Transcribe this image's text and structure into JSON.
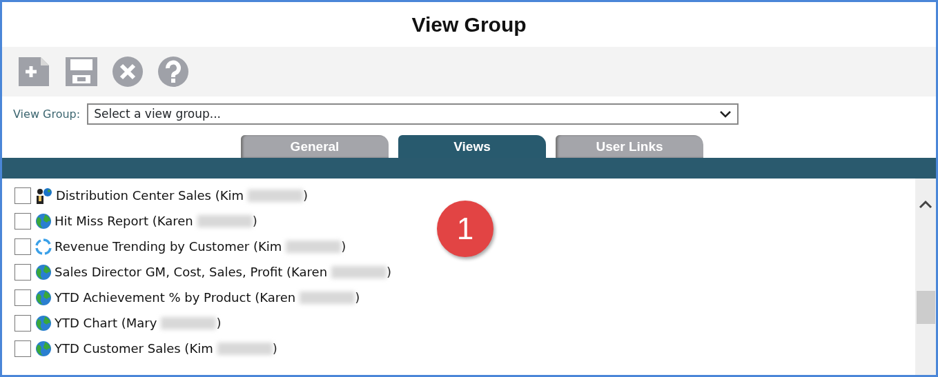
{
  "window": {
    "title": "View Group"
  },
  "toolbar": [
    {
      "kind": "new"
    },
    {
      "kind": "save"
    },
    {
      "kind": "cancel"
    },
    {
      "kind": "help"
    }
  ],
  "view_group": {
    "label": "View Group:",
    "value": "Select a view group..."
  },
  "tabs": [
    {
      "label": "General",
      "selected": false
    },
    {
      "label": "Views",
      "selected": true
    },
    {
      "label": "User Links",
      "selected": false
    }
  ],
  "views": [
    {
      "kind": "people",
      "label": "Distribution Center Sales (Kim",
      "after": ")",
      "checked": false
    },
    {
      "kind": "globe",
      "label": "Hit Miss Report (Karen",
      "after": ")",
      "checked": false
    },
    {
      "kind": "cycle",
      "label": "Revenue Trending by Customer (Kim",
      "after": ")",
      "checked": false
    },
    {
      "kind": "globe",
      "label": "Sales Director GM, Cost, Sales, Profit (Karen",
      "after": ")",
      "checked": false
    },
    {
      "kind": "globe",
      "label": "YTD Achievement % by Product (Karen",
      "after": ")",
      "checked": false
    },
    {
      "kind": "globe",
      "label": "YTD Chart (Mary",
      "after": ")",
      "checked": false
    },
    {
      "kind": "globe",
      "label": "YTD Customer Sales (Kim",
      "after": ")",
      "checked": false
    }
  ],
  "annotation_badge": "1"
}
